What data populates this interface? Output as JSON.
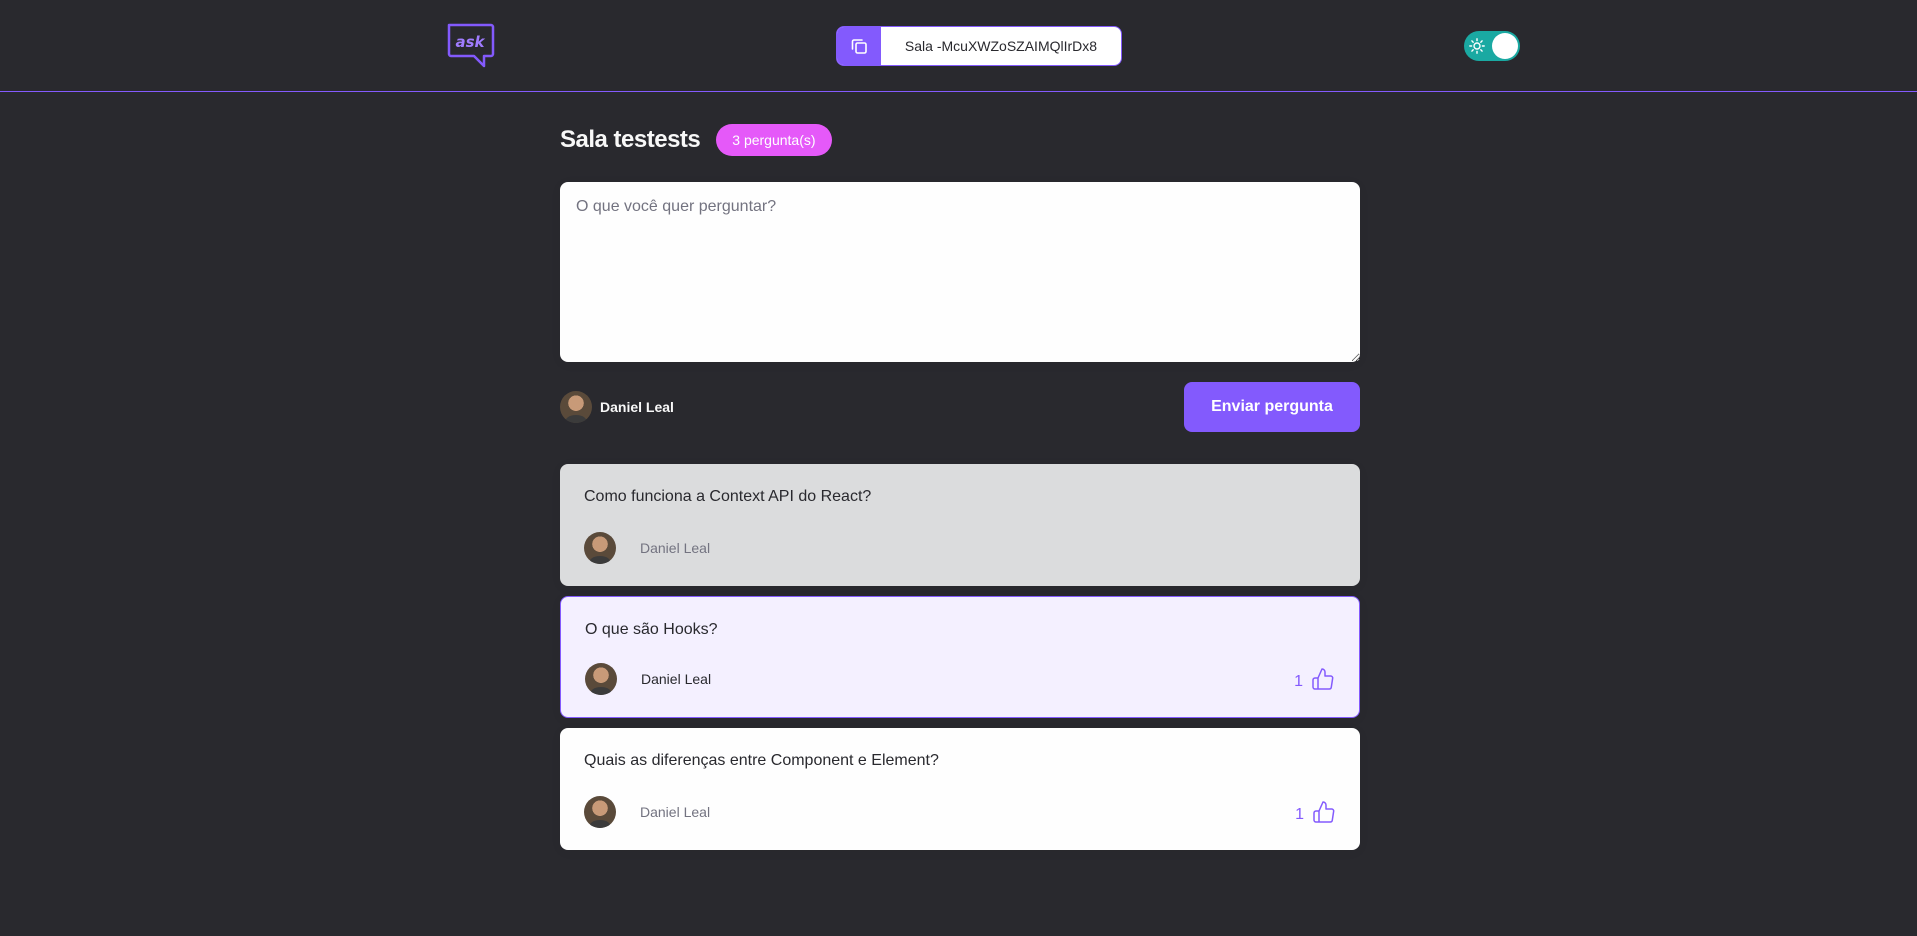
{
  "header": {
    "logo_text": "ask",
    "room_code_label": "Sala -McuXWZoSZAIMQlIrDx8",
    "theme_toggle_icon": "sun-icon"
  },
  "room": {
    "title": "Sala testests",
    "question_count": "3 pergunta(s)"
  },
  "form": {
    "placeholder": "O que você quer perguntar?",
    "user_name": "Daniel Leal",
    "send_label": "Enviar pergunta"
  },
  "questions": [
    {
      "text": "Como funciona a Context API do React?",
      "author": "Daniel Leal",
      "state": "answered"
    },
    {
      "text": "O que são Hooks?",
      "author": "Daniel Leal",
      "state": "highlighted",
      "likes": "1"
    },
    {
      "text": "Quais as diferenças entre Component e Element?",
      "author": "Daniel Leal",
      "state": "normal",
      "likes": "1"
    }
  ],
  "colors": {
    "background": "#29292e",
    "accent": "#835afd",
    "badge": "#e559f9",
    "toggle": "#1aa9a2"
  }
}
